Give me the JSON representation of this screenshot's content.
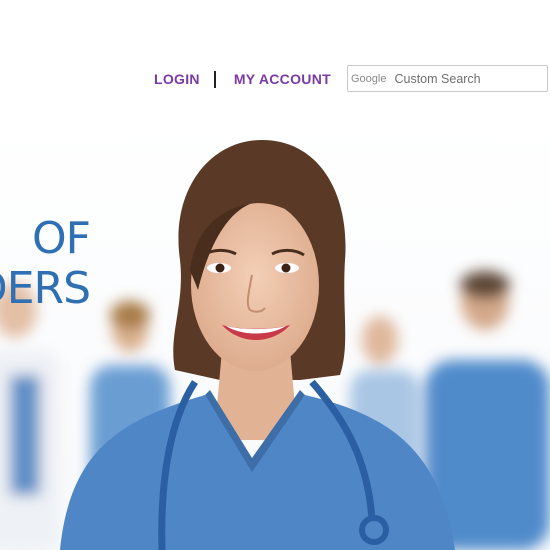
{
  "nav": {
    "login": "LOGIN",
    "my_account": "MY ACCOUNT"
  },
  "search": {
    "brand": "Google",
    "placeholder": "Custom Search"
  },
  "hero": {
    "headline_line1": "OF",
    "headline_line2": "DERS",
    "image": "smiling nurse in blue scrubs with stethoscope in front of blurred medical staff"
  },
  "colors": {
    "nav_text": "#7b3aa3",
    "headline": "#2f6fb3",
    "scrubs": "#4a86c8"
  }
}
